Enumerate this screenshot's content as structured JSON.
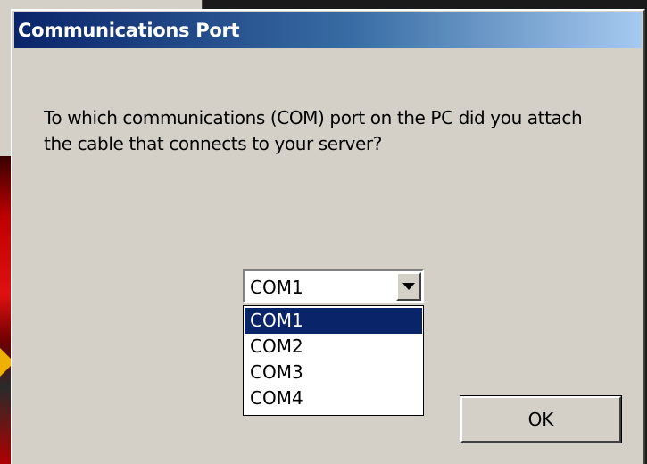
{
  "dialog": {
    "title": "Communications Port",
    "prompt": "To which communications (COM) port on the PC did you attach the cable that connects to your server?",
    "combo": {
      "selected_value": "COM1",
      "options": [
        "COM1",
        "COM2",
        "COM3",
        "COM4"
      ],
      "highlighted_index": 0
    },
    "ok_label": "OK"
  },
  "colors": {
    "titlebar_start": "#0a246a",
    "titlebar_end": "#a6caf0",
    "dialog_bg": "#d4d0c8",
    "selection_bg": "#0a246a"
  }
}
